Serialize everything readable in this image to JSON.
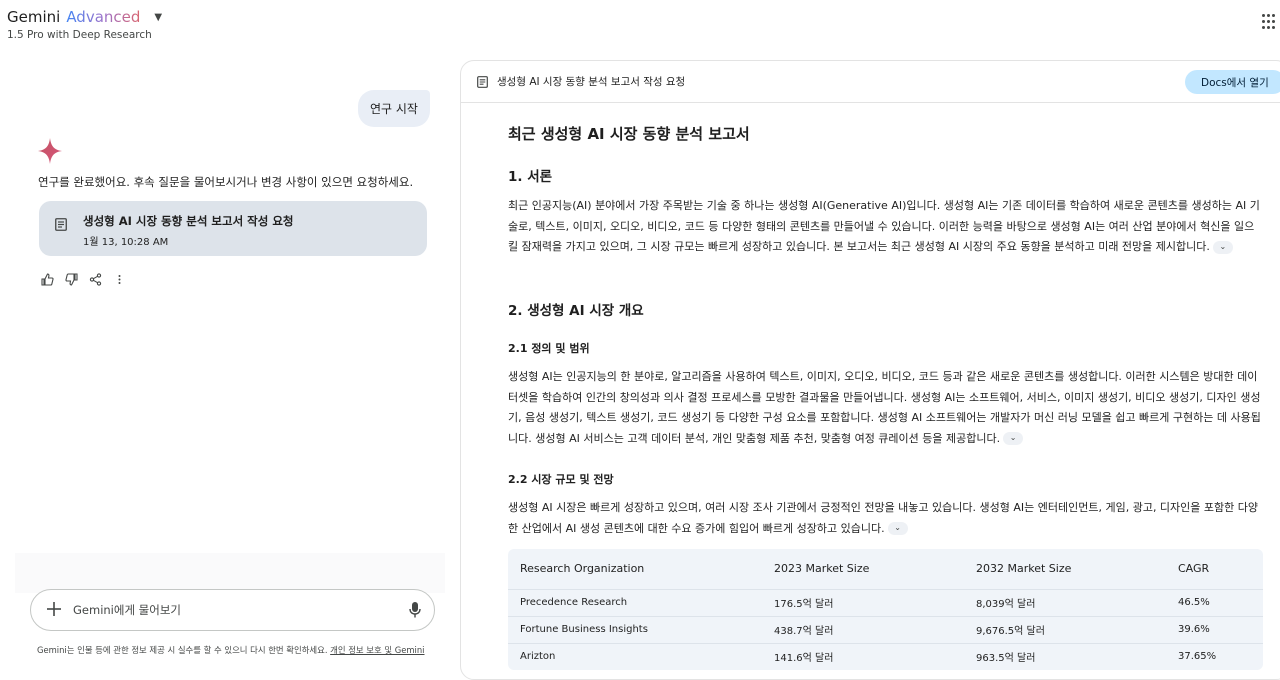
{
  "header": {
    "brand_gemini": "Gemini",
    "brand_advanced": "Advanced",
    "model_subtitle": "1.5 Pro with Deep Research"
  },
  "chat": {
    "user_message": "연구 시작",
    "reply_text": "연구를 완료했어요. 후속 질문을 물어보시거나 변경 사항이 있으면 요청하세요.",
    "report_card": {
      "title": "생성형 AI 시장 동향 분석 보고서 작성 요청",
      "date": "1월 13, 10:28 AM"
    },
    "icons": [
      "thumb-up-icon",
      "thumb-down-icon",
      "share-icon",
      "more-vert-icon"
    ]
  },
  "input": {
    "placeholder": "Gemini에게 물어보기"
  },
  "disclaimer": {
    "text": "Gemini는 인물 등에 관한 정보 제공 시 실수를 할 수 있으니 다시 한번 확인하세요. ",
    "link": "개인 정보 보호 및 Gemini"
  },
  "doc": {
    "header_title": "생성형 AI 시장 동향 분석 보고서 작성 요청",
    "open_docs_label": "Docs에서 열기",
    "title": "최근 생성형 AI 시장 동향 분석 보고서",
    "sec1_heading": "1. 서론",
    "sec1_para": "최근 인공지능(AI) 분야에서 가장 주목받는 기술 중 하나는 생성형 AI(Generative AI)입니다. 생성형 AI는 기존 데이터를 학습하여 새로운 콘텐츠를 생성하는 AI 기술로, 텍스트, 이미지, 오디오, 비디오, 코드 등 다양한 형태의 콘텐츠를 만들어낼 수 있습니다. 이러한 능력을 바탕으로 생성형 AI는 여러 산업 분야에서 혁신을 일으킬 잠재력을 가지고 있으며, 그 시장 규모는 빠르게 성장하고 있습니다. 본 보고서는 최근 생성형 AI 시장의 주요 동향을 분석하고 미래 전망을 제시합니다.",
    "sec2_heading": "2. 생성형 AI 시장 개요",
    "sec21_heading": "2.1 정의 및 범위",
    "sec21_para": "생성형 AI는 인공지능의 한 분야로, 알고리즘을 사용하여 텍스트, 이미지, 오디오, 비디오, 코드 등과 같은 새로운 콘텐츠를 생성합니다. 이러한 시스템은 방대한 데이터셋을 학습하여 인간의 창의성과 의사 결정 프로세스를 모방한 결과물을 만들어냅니다. 생성형 AI는 소프트웨어, 서비스, 이미지 생성기, 비디오 생성기, 디자인 생성기, 음성 생성기, 텍스트 생성기, 코드 생성기 등 다양한 구성 요소를 포함합니다. 생성형 AI 소프트웨어는 개발자가 머신 러닝 모델을 쉽고 빠르게 구현하는 데 사용됩니다. 생성형 AI 서비스는 고객 데이터 분석, 개인 맞춤형 제품 추천, 맞춤형 여정 큐레이션 등을 제공합니다.",
    "sec22_heading": "2.2 시장 규모 및 전망",
    "sec22_para": "생성형 AI 시장은 빠르게 성장하고 있으며, 여러 시장 조사 기관에서 긍정적인 전망을 내놓고 있습니다. 생성형 AI는 엔터테인먼트, 게임, 광고, 디자인을 포함한 다양한 산업에서 AI 생성 콘텐츠에 대한 수요 증가에 힘입어 빠르게 성장하고 있습니다.",
    "expand_glyph": "⌄",
    "table": {
      "headers": [
        "Research Organization",
        "2023 Market Size",
        "2032 Market Size",
        "CAGR"
      ],
      "rows": [
        [
          "Precedence Research",
          "176.5억 달러",
          "8,039억 달러",
          "46.5%"
        ],
        [
          "Fortune Business Insights",
          "438.7억 달러",
          "9,676.5억 달러",
          "39.6%"
        ],
        [
          "Arizton",
          "141.6억 달러",
          "963.5억 달러",
          "37.65%"
        ]
      ]
    }
  }
}
